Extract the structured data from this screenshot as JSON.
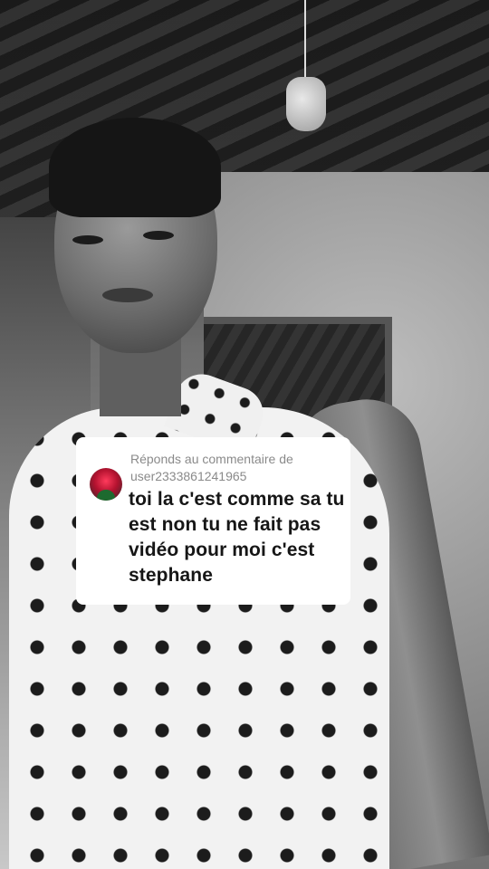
{
  "reply_card": {
    "header_prefix": "Réponds au commentaire de",
    "username": "user2333861241965",
    "comment": "toi la c'est comme sa tu est non tu ne fait pas vidéo pour moi c'est stephane"
  },
  "colors": {
    "card_bg": "#ffffff",
    "header_text": "#8a8a8a",
    "comment_text": "#161616"
  },
  "icons": {
    "commenter_avatar": "avatar"
  }
}
